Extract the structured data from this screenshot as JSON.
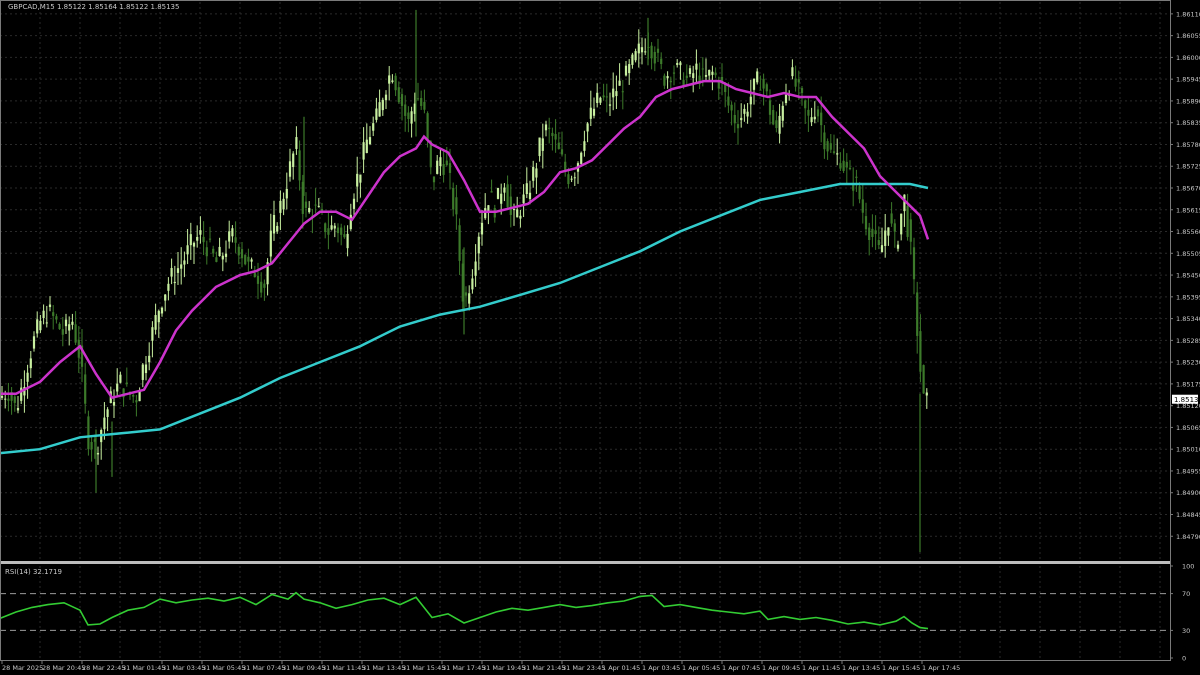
{
  "header": {
    "symbol_timeframe": "GBPCAD,M15",
    "ohlc": "1.85122 1.85164 1.85122 1.85135"
  },
  "colors": {
    "background": "#000000",
    "grid": "#2a2a2a",
    "axis_text": "#c8c8c8",
    "candle_bull": "#c8f0a0",
    "candle_bear": "#3c7a2a",
    "ma_fast": "#cc33cc",
    "ma_slow": "#33cccc",
    "rsi_line": "#33cc33",
    "price_tag_bg": "#ffffff",
    "price_tag_text": "#000000"
  },
  "chart_data": [
    {
      "type": "candlestick",
      "title": "GBPCAD,M15",
      "ylim": [
        1.8473,
        1.8614
      ],
      "grid": true,
      "y_ticks": [
        "1.86110",
        "1.86055",
        "1.86000",
        "1.85945",
        "1.85890",
        "1.85835",
        "1.85780",
        "1.85725",
        "1.85670",
        "1.85615",
        "1.85560",
        "1.85505",
        "1.85450",
        "1.85395",
        "1.85340",
        "1.85285",
        "1.85230",
        "1.85175",
        "1.85120",
        "1.85065",
        "1.85010",
        "1.84955",
        "1.84900",
        "1.84845",
        "1.84790"
      ],
      "current_price": "1.85135",
      "x_ticks": [
        "28 Mar 2025",
        "28 Mar 20:45",
        "28 Mar 22:45",
        "31 Mar 01:45",
        "31 Mar 03:45",
        "31 Mar 05:45",
        "31 Mar 07:45",
        "31 Mar 09:45",
        "31 Mar 11:45",
        "31 Mar 13:45",
        "31 Mar 15:45",
        "31 Mar 17:45",
        "31 Mar 19:45",
        "31 Mar 21:45",
        "31 Mar 23:45",
        "1 Apr 01:45",
        "1 Apr 03:45",
        "1 Apr 05:45",
        "1 Apr 07:45",
        "1 Apr 09:45",
        "1 Apr 11:45",
        "1 Apr 13:45",
        "1 Apr 15:45",
        "1 Apr 17:45"
      ],
      "close_path": [
        [
          0,
          1.8514
        ],
        [
          8,
          1.8516
        ],
        [
          16,
          1.8511
        ],
        [
          24,
          1.8519
        ],
        [
          32,
          1.8527
        ],
        [
          40,
          1.8533
        ],
        [
          48,
          1.8536
        ],
        [
          56,
          1.8533
        ],
        [
          64,
          1.853
        ],
        [
          72,
          1.8534
        ],
        [
          80,
          1.8524
        ],
        [
          88,
          1.8504
        ],
        [
          96,
          1.8501
        ],
        [
          104,
          1.8509
        ],
        [
          112,
          1.8514
        ],
        [
          120,
          1.8518
        ],
        [
          128,
          1.8515
        ],
        [
          136,
          1.8514
        ],
        [
          144,
          1.8523
        ],
        [
          152,
          1.853
        ],
        [
          160,
          1.8538
        ],
        [
          168,
          1.8543
        ],
        [
          176,
          1.8546
        ],
        [
          184,
          1.8549
        ],
        [
          192,
          1.8553
        ],
        [
          200,
          1.8555
        ],
        [
          208,
          1.8552
        ],
        [
          216,
          1.8548
        ],
        [
          224,
          1.8551
        ],
        [
          232,
          1.8555
        ],
        [
          240,
          1.8552
        ],
        [
          248,
          1.8547
        ],
        [
          256,
          1.8546
        ],
        [
          264,
          1.8542
        ],
        [
          272,
          1.8556
        ],
        [
          280,
          1.8562
        ],
        [
          288,
          1.857
        ],
        [
          296,
          1.8578
        ],
        [
          304,
          1.856
        ],
        [
          312,
          1.8562
        ],
        [
          320,
          1.856
        ],
        [
          328,
          1.8556
        ],
        [
          336,
          1.8558
        ],
        [
          344,
          1.8553
        ],
        [
          352,
          1.8565
        ],
        [
          360,
          1.8572
        ],
        [
          368,
          1.858
        ],
        [
          376,
          1.8584
        ],
        [
          384,
          1.8592
        ],
        [
          392,
          1.8597
        ],
        [
          400,
          1.859
        ],
        [
          408,
          1.8583
        ],
        [
          416,
          1.8591
        ],
        [
          424,
          1.8586
        ],
        [
          432,
          1.8568
        ],
        [
          440,
          1.8575
        ],
        [
          448,
          1.8571
        ],
        [
          456,
          1.8559
        ],
        [
          464,
          1.8537
        ],
        [
          472,
          1.8546
        ],
        [
          480,
          1.8558
        ],
        [
          488,
          1.8565
        ],
        [
          496,
          1.8562
        ],
        [
          504,
          1.857
        ],
        [
          512,
          1.8558
        ],
        [
          520,
          1.8562
        ],
        [
          528,
          1.8566
        ],
        [
          536,
          1.8573
        ],
        [
          544,
          1.8582
        ],
        [
          552,
          1.858
        ],
        [
          560,
          1.8575
        ],
        [
          568,
          1.857
        ],
        [
          576,
          1.8572
        ],
        [
          584,
          1.8581
        ],
        [
          592,
          1.8586
        ],
        [
          600,
          1.859
        ],
        [
          608,
          1.8588
        ],
        [
          616,
          1.8592
        ],
        [
          624,
          1.8594
        ],
        [
          632,
          1.8598
        ],
        [
          640,
          1.8602
        ],
        [
          648,
          1.8605
        ],
        [
          656,
          1.86
        ],
        [
          664,
          1.8595
        ],
        [
          672,
          1.8597
        ],
        [
          680,
          1.8596
        ],
        [
          688,
          1.8594
        ],
        [
          696,
          1.8597
        ],
        [
          704,
          1.8594
        ],
        [
          712,
          1.8596
        ],
        [
          720,
          1.8594
        ],
        [
          728,
          1.8588
        ],
        [
          736,
          1.8584
        ],
        [
          744,
          1.8586
        ],
        [
          752,
          1.8591
        ],
        [
          760,
          1.8595
        ],
        [
          768,
          1.8589
        ],
        [
          776,
          1.858
        ],
        [
          784,
          1.8591
        ],
        [
          792,
          1.8595
        ],
        [
          800,
          1.859
        ],
        [
          808,
          1.8584
        ],
        [
          816,
          1.8588
        ],
        [
          824,
          1.858
        ],
        [
          832,
          1.8575
        ],
        [
          840,
          1.8575
        ],
        [
          848,
          1.857
        ],
        [
          856,
          1.8568
        ],
        [
          864,
          1.856
        ],
        [
          872,
          1.8555
        ],
        [
          880,
          1.855
        ],
        [
          888,
          1.856
        ],
        [
          896,
          1.8552
        ],
        [
          904,
          1.8565
        ],
        [
          912,
          1.8548
        ],
        [
          920,
          1.8522
        ],
        [
          924,
          1.8512
        ],
        [
          928,
          1.8513
        ]
      ],
      "spikes": [
        [
          96,
          1.8506,
          1.849
        ],
        [
          112,
          1.8508,
          1.8494
        ],
        [
          464,
          1.8552,
          1.853
        ],
        [
          920,
          1.8515,
          1.8475
        ],
        [
          304,
          1.8585,
          1.8565
        ],
        [
          416,
          1.8612,
          1.858
        ],
        [
          648,
          1.861,
          1.8598
        ]
      ],
      "series": [
        {
          "points": [
            [
              0,
              1.8515
            ],
            [
              16,
              1.8515
            ],
            [
              40,
              1.8518
            ],
            [
              60,
              1.8523
            ],
            [
              80,
              1.8527
            ],
            [
              96,
              1.852
            ],
            [
              112,
              1.8514
            ],
            [
              144,
              1.8516
            ],
            [
              160,
              1.8523
            ],
            [
              176,
              1.8531
            ],
            [
              192,
              1.8536
            ],
            [
              216,
              1.8542
            ],
            [
              240,
              1.8545
            ],
            [
              256,
              1.8546
            ],
            [
              272,
              1.8548
            ],
            [
              288,
              1.8553
            ],
            [
              304,
              1.8558
            ],
            [
              320,
              1.8561
            ],
            [
              336,
              1.8561
            ],
            [
              352,
              1.8559
            ],
            [
              368,
              1.8565
            ],
            [
              384,
              1.8571
            ],
            [
              400,
              1.8575
            ],
            [
              416,
              1.8577
            ],
            [
              424,
              1.858
            ],
            [
              432,
              1.8578
            ],
            [
              448,
              1.8576
            ],
            [
              464,
              1.8569
            ],
            [
              480,
              1.8561
            ],
            [
              496,
              1.8561
            ],
            [
              512,
              1.8562
            ],
            [
              528,
              1.8563
            ],
            [
              544,
              1.8566
            ],
            [
              560,
              1.8571
            ],
            [
              576,
              1.8572
            ],
            [
              592,
              1.8574
            ],
            [
              608,
              1.8578
            ],
            [
              624,
              1.8582
            ],
            [
              640,
              1.8585
            ],
            [
              656,
              1.859
            ],
            [
              672,
              1.8592
            ],
            [
              688,
              1.8593
            ],
            [
              704,
              1.8594
            ],
            [
              720,
              1.8594
            ],
            [
              736,
              1.8592
            ],
            [
              752,
              1.8591
            ],
            [
              768,
              1.859
            ],
            [
              784,
              1.8591
            ],
            [
              800,
              1.859
            ],
            [
              816,
              1.859
            ],
            [
              832,
              1.8585
            ],
            [
              848,
              1.8581
            ],
            [
              864,
              1.8577
            ],
            [
              880,
              1.857
            ],
            [
              896,
              1.8566
            ],
            [
              912,
              1.8562
            ],
            [
              920,
              1.856
            ],
            [
              928,
              1.8554
            ]
          ]
        },
        {
          "points": [
            [
              0,
              1.85
            ],
            [
              40,
              1.8501
            ],
            [
              80,
              1.8504
            ],
            [
              120,
              1.8505
            ],
            [
              160,
              1.8506
            ],
            [
              200,
              1.851
            ],
            [
              240,
              1.8514
            ],
            [
              280,
              1.8519
            ],
            [
              320,
              1.8523
            ],
            [
              360,
              1.8527
            ],
            [
              400,
              1.8532
            ],
            [
              440,
              1.8535
            ],
            [
              480,
              1.8537
            ],
            [
              520,
              1.854
            ],
            [
              560,
              1.8543
            ],
            [
              600,
              1.8547
            ],
            [
              640,
              1.8551
            ],
            [
              680,
              1.8556
            ],
            [
              720,
              1.856
            ],
            [
              760,
              1.8564
            ],
            [
              800,
              1.8566
            ],
            [
              840,
              1.8568
            ],
            [
              880,
              1.8568
            ],
            [
              910,
              1.8568
            ],
            [
              928,
              1.8567
            ]
          ]
        }
      ]
    },
    {
      "type": "line",
      "title": "RSI(14) 32.1719",
      "ylim": [
        0,
        100
      ],
      "y_ticks": [
        "100",
        "70",
        "30",
        "0"
      ],
      "levels": [
        70,
        30
      ],
      "series": [
        {
          "points": [
            [
              0,
              43
            ],
            [
              16,
              50
            ],
            [
              32,
              55
            ],
            [
              48,
              58
            ],
            [
              64,
              60
            ],
            [
              80,
              52
            ],
            [
              88,
              36
            ],
            [
              100,
              37
            ],
            [
              112,
              44
            ],
            [
              128,
              52
            ],
            [
              144,
              55
            ],
            [
              160,
              64
            ],
            [
              176,
              60
            ],
            [
              192,
              63
            ],
            [
              208,
              65
            ],
            [
              224,
              62
            ],
            [
              240,
              66
            ],
            [
              256,
              58
            ],
            [
              272,
              69
            ],
            [
              288,
              64
            ],
            [
              296,
              71
            ],
            [
              304,
              64
            ],
            [
              320,
              60
            ],
            [
              336,
              54
            ],
            [
              352,
              58
            ],
            [
              368,
              63
            ],
            [
              384,
              65
            ],
            [
              400,
              58
            ],
            [
              416,
              66
            ],
            [
              432,
              44
            ],
            [
              448,
              48
            ],
            [
              464,
              38
            ],
            [
              480,
              44
            ],
            [
              496,
              50
            ],
            [
              512,
              54
            ],
            [
              528,
              52
            ],
            [
              544,
              55
            ],
            [
              560,
              58
            ],
            [
              576,
              55
            ],
            [
              592,
              57
            ],
            [
              608,
              60
            ],
            [
              624,
              62
            ],
            [
              640,
              67
            ],
            [
              652,
              68
            ],
            [
              664,
              56
            ],
            [
              680,
              58
            ],
            [
              696,
              55
            ],
            [
              712,
              52
            ],
            [
              728,
              50
            ],
            [
              744,
              48
            ],
            [
              760,
              51
            ],
            [
              768,
              42
            ],
            [
              784,
              45
            ],
            [
              800,
              42
            ],
            [
              816,
              44
            ],
            [
              832,
              41
            ],
            [
              848,
              37
            ],
            [
              864,
              39
            ],
            [
              880,
              36
            ],
            [
              896,
              40
            ],
            [
              904,
              45
            ],
            [
              912,
              38
            ],
            [
              920,
              33
            ],
            [
              928,
              32
            ]
          ]
        }
      ]
    }
  ]
}
